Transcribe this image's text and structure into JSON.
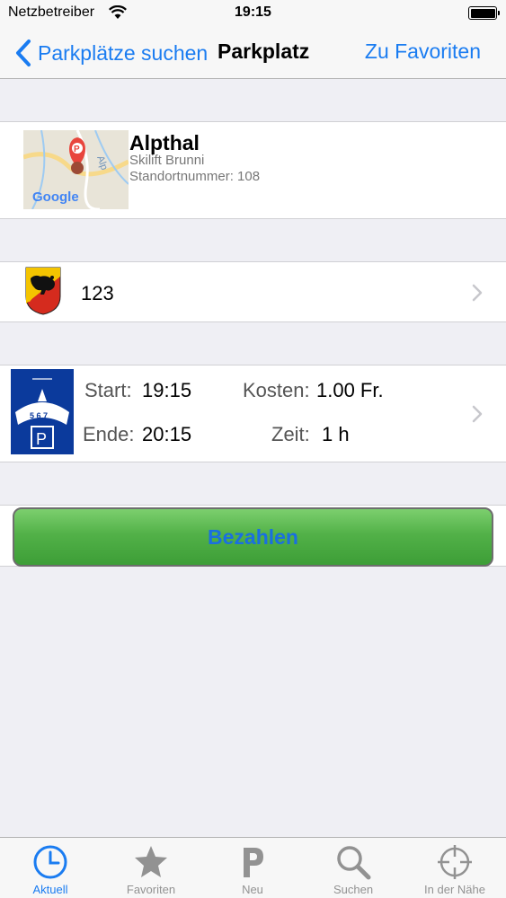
{
  "status_bar": {
    "carrier": "Netzbetreiber",
    "time": "19:15"
  },
  "nav": {
    "back_label": "Parkplätze suchen",
    "title": "Parkplatz",
    "right_action": "Zu Favoriten"
  },
  "location": {
    "name": "Alpthal",
    "subtitle": "Skilift Brunni",
    "number_text": "Standortnummer: 108",
    "map_logo": "Google",
    "map_road_label": "Alp"
  },
  "plate": {
    "number": "123",
    "canton_icon": "bern-crest-icon"
  },
  "parking_time": {
    "start_label": "Start:",
    "start_value": "19:15",
    "end_label": "Ende:",
    "end_value": "20:15",
    "cost_label": "Kosten:",
    "cost_value": "1.00 Fr.",
    "duration_label": "Zeit:",
    "duration_value": "1 h",
    "disc_digits": "5 6 7",
    "disc_letter": "P"
  },
  "pay_button": {
    "label": "Bezahlen"
  },
  "tabs": [
    {
      "label": "Aktuell",
      "icon": "clock-icon",
      "active": true
    },
    {
      "label": "Favoriten",
      "icon": "star-icon",
      "active": false
    },
    {
      "label": "Neu",
      "icon": "parking-p-icon",
      "active": false
    },
    {
      "label": "Suchen",
      "icon": "search-icon",
      "active": false
    },
    {
      "label": "In der Nähe",
      "icon": "crosshair-icon",
      "active": false
    }
  ],
  "colors": {
    "accent": "#1a7cf1",
    "pay_green": "#52b148",
    "inactive_tab": "#929292",
    "background": "#efeff4"
  }
}
